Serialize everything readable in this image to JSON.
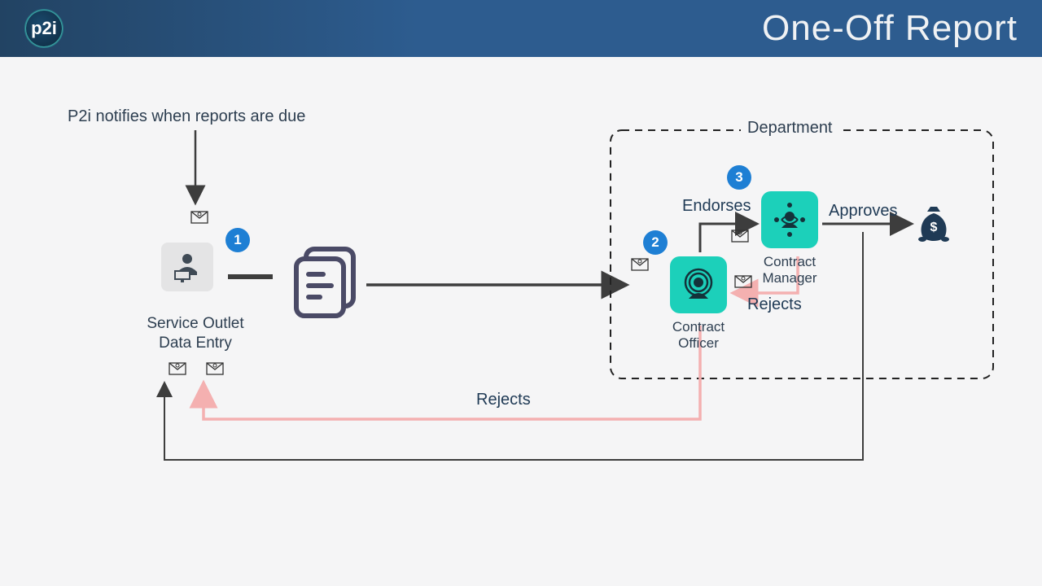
{
  "header": {
    "logo": "p2i",
    "title": "One-Off Report"
  },
  "notify": "P2i notifies when reports are due",
  "steps": {
    "s1": "1",
    "s2": "2",
    "s3": "3"
  },
  "roles": {
    "service_outlet_l1": "Service Outlet",
    "service_outlet_l2": "Data Entry",
    "department": "Department",
    "contract_officer_l1": "Contract",
    "contract_officer_l2": "Officer",
    "contract_manager_l1": "Contract",
    "contract_manager_l2": "Manager"
  },
  "actions": {
    "endorses": "Endorses",
    "approves": "Approves",
    "rejects_cm": "Rejects",
    "rejects_co": "Rejects"
  }
}
